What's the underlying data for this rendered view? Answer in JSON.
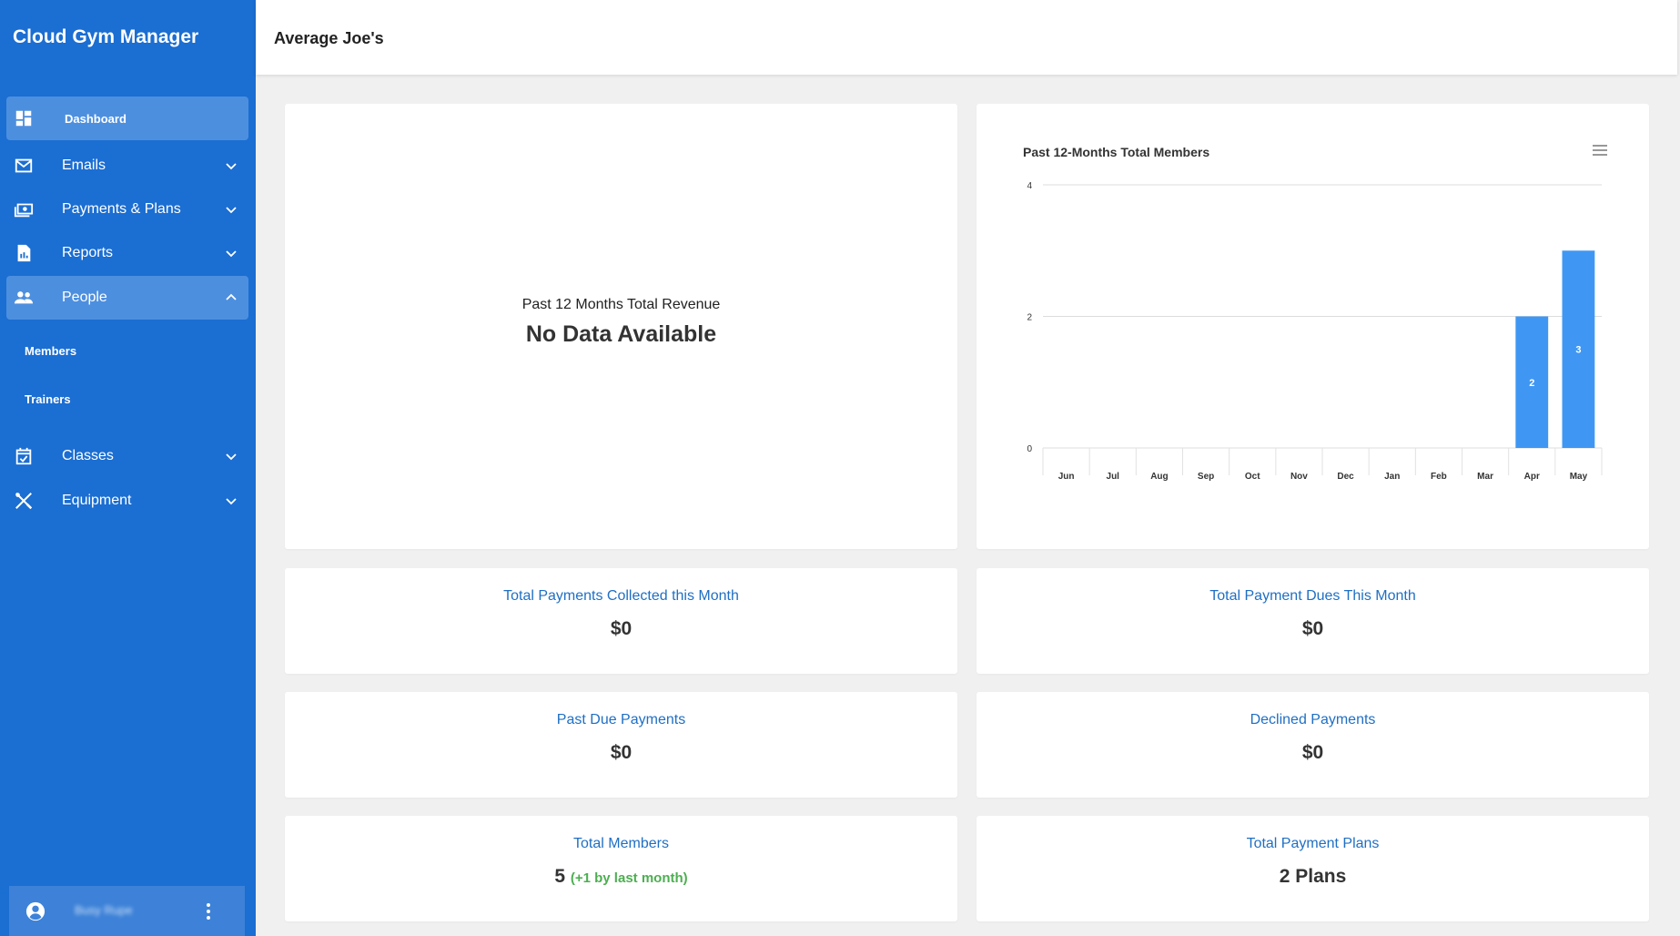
{
  "app": {
    "title": "Cloud Gym Manager"
  },
  "header": {
    "gym_name": "Average Joe's"
  },
  "sidebar": {
    "items": [
      {
        "label": "Dashboard",
        "icon": "dashboard-icon",
        "active": true
      },
      {
        "label": "Emails",
        "icon": "mail-icon",
        "expanded": false
      },
      {
        "label": "Payments & Plans",
        "icon": "payments-icon",
        "expanded": false
      },
      {
        "label": "Reports",
        "icon": "report-icon",
        "expanded": false
      },
      {
        "label": "People",
        "icon": "people-icon",
        "expanded": true
      },
      {
        "label": "Classes",
        "icon": "calendar-check-icon",
        "expanded": false
      },
      {
        "label": "Equipment",
        "icon": "tools-icon",
        "expanded": false
      }
    ],
    "people_sub": [
      {
        "label": "Members"
      },
      {
        "label": "Trainers"
      }
    ],
    "user": {
      "name": "Busy Rupe"
    }
  },
  "revenue_card": {
    "label": "Past 12 Months Total Revenue",
    "value": "No Data Available"
  },
  "stats": {
    "payments_collected": {
      "label": "Total Payments Collected this Month",
      "value": "$0"
    },
    "payment_dues": {
      "label": "Total Payment Dues This Month",
      "value": "$0"
    },
    "past_due": {
      "label": "Past Due Payments",
      "value": "$0"
    },
    "declined": {
      "label": "Declined Payments",
      "value": "$0"
    },
    "total_members": {
      "label": "Total Members",
      "value": "5",
      "delta": "(+1 by last month)"
    },
    "payment_plans": {
      "label": "Total Payment Plans",
      "value": "2 Plans"
    }
  },
  "colors": {
    "sidebar": "#1b6ed2",
    "accent": "#1f6fc4",
    "bar": "#3f97f3",
    "positive": "#4caf50"
  },
  "chart_data": {
    "type": "bar",
    "title": "Past 12-Months Total Members",
    "categories": [
      "Jun",
      "Jul",
      "Aug",
      "Sep",
      "Oct",
      "Nov",
      "Dec",
      "Jan",
      "Feb",
      "Mar",
      "Apr",
      "May"
    ],
    "values": [
      0,
      0,
      0,
      0,
      0,
      0,
      0,
      0,
      0,
      0,
      2,
      3
    ],
    "data_labels": [
      "",
      "",
      "",
      "",
      "",
      "",
      "",
      "",
      "",
      "",
      "2",
      "3"
    ],
    "yticks": [
      "0",
      "2",
      "4"
    ],
    "ylim": [
      0,
      4
    ],
    "grid": true,
    "legend": "none"
  }
}
